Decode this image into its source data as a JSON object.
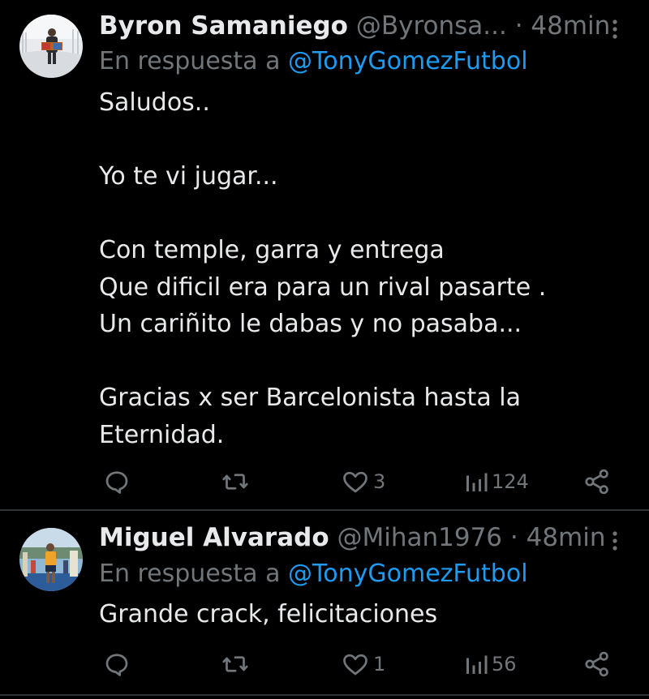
{
  "colors": {
    "background": "#000000",
    "text": "#e7e9ea",
    "muted": "#71767b",
    "link": "#1d9bf0",
    "divider": "#2f3336"
  },
  "tweets": [
    {
      "name": "Byron Samaniego",
      "handle": "@Byronsa...",
      "separator": "·",
      "time": "48min",
      "reply_prefix": "En respuesta a",
      "reply_mention": "@TonyGomezFutbol",
      "lines": [
        "Saludos..",
        "",
        "Yo te vi jugar...",
        "",
        "Con temple, garra y entrega",
        "Que dificil era para un rival pasarte .",
        "Un cariñito le dabas y no pasaba...",
        "",
        "Gracias x ser Barcelonista hasta la",
        "Eternidad."
      ],
      "likes": "3",
      "views": "124",
      "icons": {
        "reply": "reply-icon",
        "retweet": "retweet-icon",
        "like": "heart-icon",
        "views": "views-icon",
        "share": "share-icon",
        "more": "more-icon"
      }
    },
    {
      "name": "Miguel Alvarado",
      "handle": "@Mihan1976",
      "separator": "·",
      "time": "48min",
      "reply_prefix": "En respuesta a",
      "reply_mention": "@TonyGomezFutbol",
      "lines": [
        "Grande crack, felicitaciones"
      ],
      "likes": "1",
      "views": "56",
      "icons": {
        "reply": "reply-icon",
        "retweet": "retweet-icon",
        "like": "heart-icon",
        "views": "views-icon",
        "share": "share-icon",
        "more": "more-icon"
      }
    }
  ]
}
